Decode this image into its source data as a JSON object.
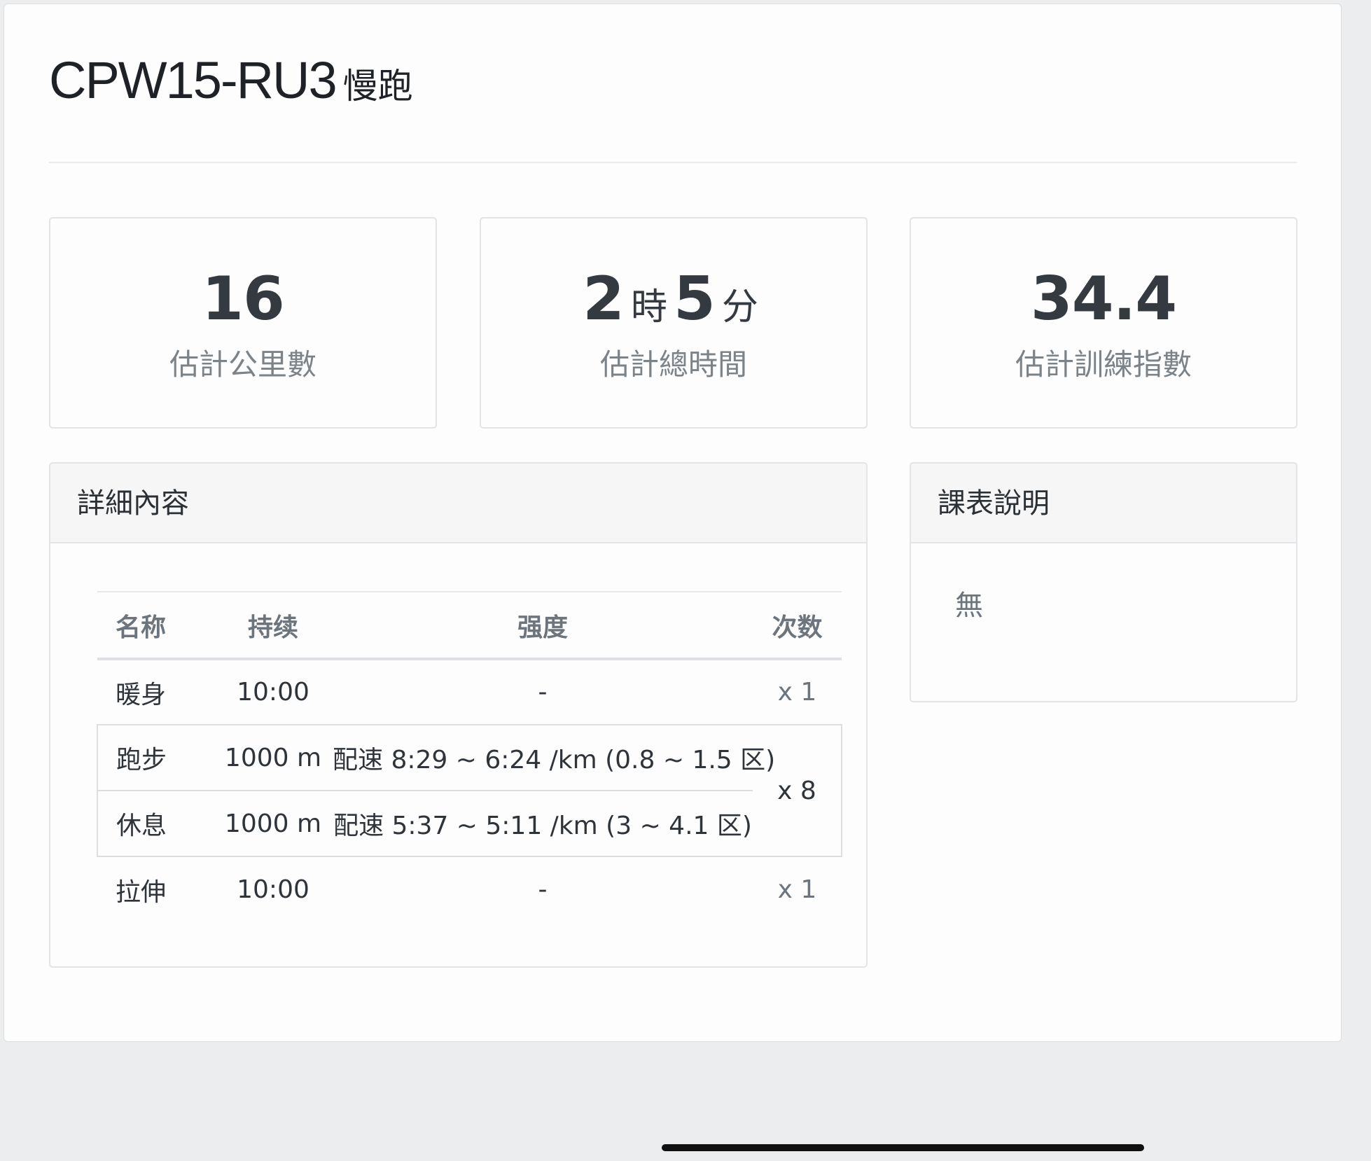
{
  "workout": {
    "code": "CPW15-RU3",
    "type": "慢跑"
  },
  "stats": {
    "distance": {
      "value": "16",
      "label": "估計公里數"
    },
    "duration": {
      "hours": "2",
      "hours_unit": "時",
      "minutes": "5",
      "minutes_unit": "分",
      "label": "估計總時間"
    },
    "training_index": {
      "value": "34.4",
      "label": "估計訓練指數"
    }
  },
  "details": {
    "title": "詳細內容",
    "columns": {
      "name": "名称",
      "duration": "持续",
      "intensity": "强度",
      "reps": "次数"
    },
    "rows": [
      {
        "name": "暖身",
        "duration": "10:00",
        "intensity": "-",
        "reps": "x 1"
      },
      {
        "name": "跑步",
        "duration": "1000 m",
        "intensity": "配速 8:29 ~ 6:24 /km (0.8 ~ 1.5 区)",
        "reps": "x 8"
      },
      {
        "name": "休息",
        "duration": "1000 m",
        "intensity": "配速 5:37 ~ 5:11 /km (3 ~ 4.1 区)"
      },
      {
        "name": "拉伸",
        "duration": "10:00",
        "intensity": "-",
        "reps": "x 1"
      }
    ]
  },
  "notes": {
    "title": "課表說明",
    "body": "無"
  }
}
